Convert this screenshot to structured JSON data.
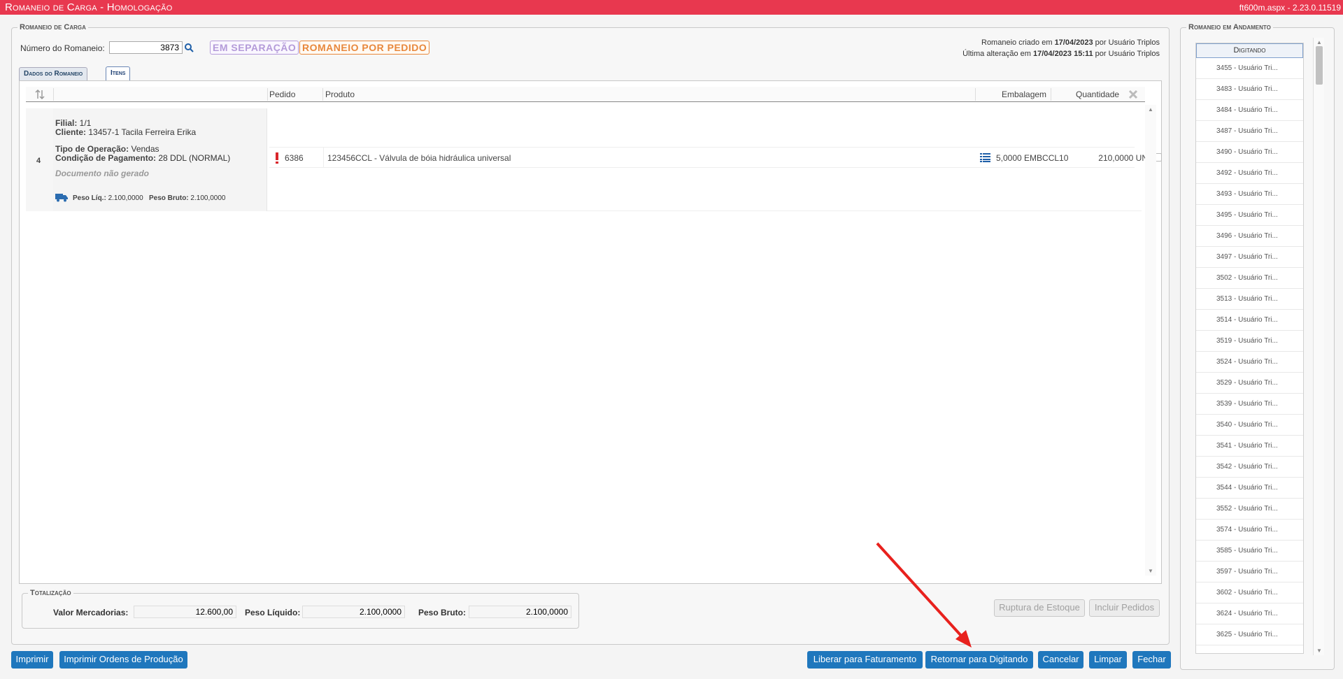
{
  "titlebar": {
    "title": "Romaneio de Carga  - Homologação",
    "version": "ft600m.aspx - 2.23.0.11519"
  },
  "main": {
    "legend": "Romaneio de Carga",
    "numero_label": "Número do Romaneio:",
    "numero_value": "3873",
    "badge_status": "EM SEPARAÇÃO",
    "badge_tipo": "ROMANEIO POR PEDIDO",
    "created": {
      "prefix": "Romaneio criado em ",
      "date": "17/04/2023",
      "suffix": " por Usuário Triplos"
    },
    "updated": {
      "prefix": "Última alteração em ",
      "date": "17/04/2023 15:11",
      "suffix": " por Usuário Triplos"
    },
    "tabs": [
      {
        "label": "Dados do Romaneio"
      },
      {
        "label": "Itens"
      }
    ]
  },
  "grid": {
    "headers": {
      "pedido": "Pedido",
      "produto": "Produto",
      "embalagem": "Embalagem",
      "quantidade": "Quantidade"
    },
    "row": {
      "num": "4",
      "filial_label": "Filial:",
      "filial": " 1/1",
      "cliente_label": "Cliente:",
      "cliente": " 13457-1 Tacila Ferreira Erika",
      "tipo_label": "Tipo de Operação:",
      "tipo": " Vendas",
      "cond_label": "Condição de Pagamento:",
      "cond": " 28 DDL (NORMAL)",
      "documento": "Documento não gerado",
      "peso_liq_label": "Peso Líq.:",
      "peso_liq": " 2.100,0000",
      "peso_bruto_label": "Peso Bruto:",
      "peso_bruto": " 2.100,0000",
      "item": {
        "pedido": "6386",
        "produto": "123456CCL - Válvula de bóia hidráulica universal",
        "embalagem": "5,0000 EMBCCL10",
        "quantidade": "210,0000 UN"
      }
    }
  },
  "totalizacao": {
    "legend": "Totalização",
    "valor_label": "Valor Mercadorias:",
    "valor": "12.600,00",
    "liquido_label": "Peso Líquido:",
    "liquido": "2.100,0000",
    "bruto_label": "Peso Bruto:",
    "bruto": "2.100,0000"
  },
  "buttons": {
    "ruptura": "Ruptura de Estoque",
    "incluir": "Incluir Pedidos",
    "imprimir": "Imprimir",
    "imprimir_op": "Imprimir Ordens de Produção",
    "liberar": "Liberar para Faturamento",
    "retornar": "Retornar para Digitando",
    "cancelar": "Cancelar",
    "limpar": "Limpar",
    "fechar": "Fechar"
  },
  "side": {
    "legend": "Romaneio em Andamento",
    "header": "Digitando",
    "items": [
      "3455 - Usuário Tri...",
      "3483 - Usuário Tri...",
      "3484 - Usuário Tri...",
      "3487 - Usuário Tri...",
      "3490 - Usuário Tri...",
      "3492 - Usuário Tri...",
      "3493 - Usuário Tri...",
      "3495 - Usuário Tri...",
      "3496 - Usuário Tri...",
      "3497 - Usuário Tri...",
      "3502 - Usuário Tri...",
      "3513 - Usuário Tri...",
      "3514 - Usuário Tri...",
      "3519 - Usuário Tri...",
      "3524 - Usuário Tri...",
      "3529 - Usuário Tri...",
      "3539 - Usuário Tri...",
      "3540 - Usuário Tri...",
      "3541 - Usuário Tri...",
      "3542 - Usuário Tri...",
      "3544 - Usuário Tri...",
      "3552 - Usuário Tri...",
      "3574 - Usuário Tri...",
      "3585 - Usuário Tri...",
      "3597 - Usuário Tri...",
      "3602 - Usuário Tri...",
      "3624 - Usuário Tri...",
      "3625 - Usuário Tri..."
    ]
  },
  "colors": {
    "titlebar": "#e8384f",
    "button": "#1f77bd",
    "annotation_arrow": "#e8211d"
  }
}
